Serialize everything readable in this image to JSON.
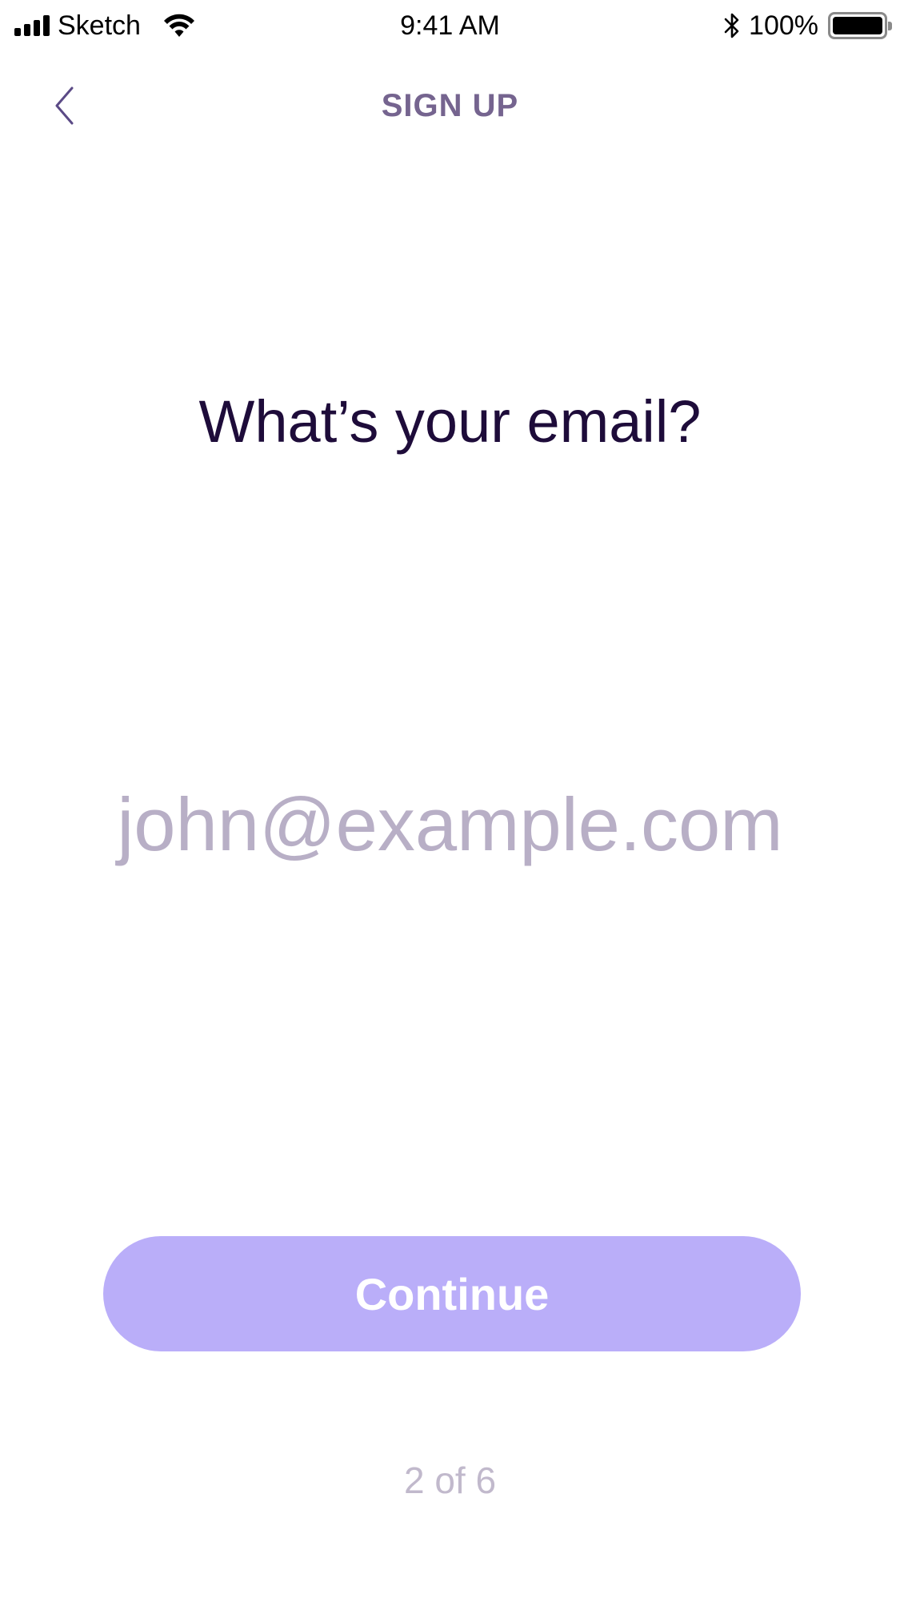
{
  "status_bar": {
    "carrier": "Sketch",
    "time": "9:41 AM",
    "battery_percent": "100%",
    "icons": [
      "signal-icon",
      "wifi-icon",
      "bluetooth-icon",
      "battery-icon"
    ]
  },
  "nav": {
    "title": "SIGN UP",
    "back_icon": "chevron-left-icon"
  },
  "form": {
    "question": "What’s your email?",
    "email_value": "",
    "email_placeholder": "john@example.com",
    "continue_label": "Continue"
  },
  "progress": {
    "label": "2 of 6",
    "current_step": 2,
    "total_steps": 6
  },
  "colors": {
    "nav_title": "#75648f",
    "question_text": "#1e0c3a",
    "placeholder_text": "#b8afc6",
    "button_background": "#baaef9",
    "button_text": "#ffffff",
    "step_text": "#c1b9cc",
    "back_chevron": "#5b4a86"
  }
}
